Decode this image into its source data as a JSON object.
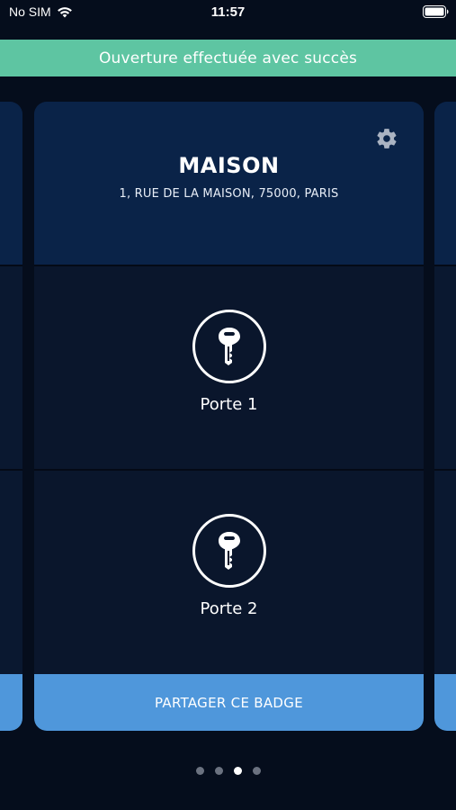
{
  "status_bar": {
    "carrier": "No SIM",
    "time": "11:57"
  },
  "toast": {
    "message": "Ouverture effectuée avec succès",
    "color": "#5ec5a2"
  },
  "card": {
    "title": "MAISON",
    "address": "1, RUE DE LA MAISON, 75000, PARIS",
    "doors": [
      {
        "label": "Porte 1",
        "icon": "key-icon"
      },
      {
        "label": "Porte 2",
        "icon": "key-icon"
      }
    ],
    "share_label": "PARTAGER CE BADGE"
  },
  "pagination": {
    "count": 4,
    "active_index": 2
  },
  "colors": {
    "background": "#050d1c",
    "card_header": "#0a2348",
    "door_section": "#0a162c",
    "share_button": "#4f97db"
  }
}
